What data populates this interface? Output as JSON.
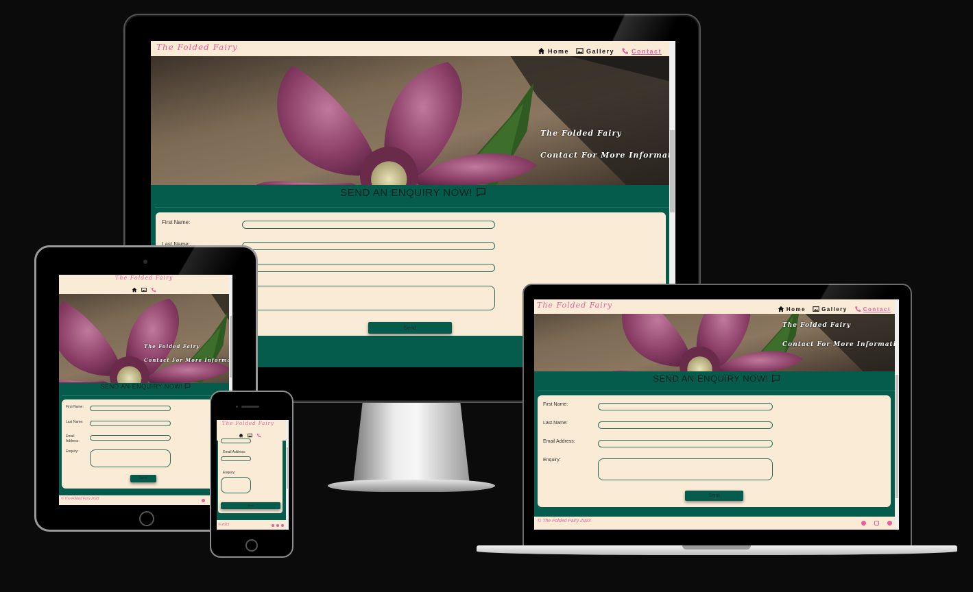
{
  "site": {
    "logo": "The Folded Fairy",
    "nav": {
      "home": "Home",
      "gallery": "Gallery",
      "contact": "Contact"
    },
    "hero": {
      "tagline_1": "The Folded Fairy",
      "tagline_2": "Contact For More Information"
    },
    "section_title": "SEND AN ENQUIRY NOW!",
    "form": {
      "first_name": "First Name:",
      "last_name": "Last Name:",
      "email": "Email Address:",
      "email_short_1": "Email",
      "email_short_2": "Address:",
      "enquiry": "Enquiry:",
      "send": "Send"
    },
    "footer": {
      "copyright": "© The Folded Fairy 2023",
      "copyright_short": "© 2023"
    }
  },
  "colors": {
    "accent": "#e7609b",
    "brand_green": "#055c4c",
    "cream": "#faebd7",
    "background": "#0b0b0b"
  },
  "icons": [
    "home-icon",
    "image-icon",
    "phone-icon",
    "chat-bubble-icon",
    "facebook-icon",
    "instagram-icon",
    "pinterest-icon"
  ]
}
